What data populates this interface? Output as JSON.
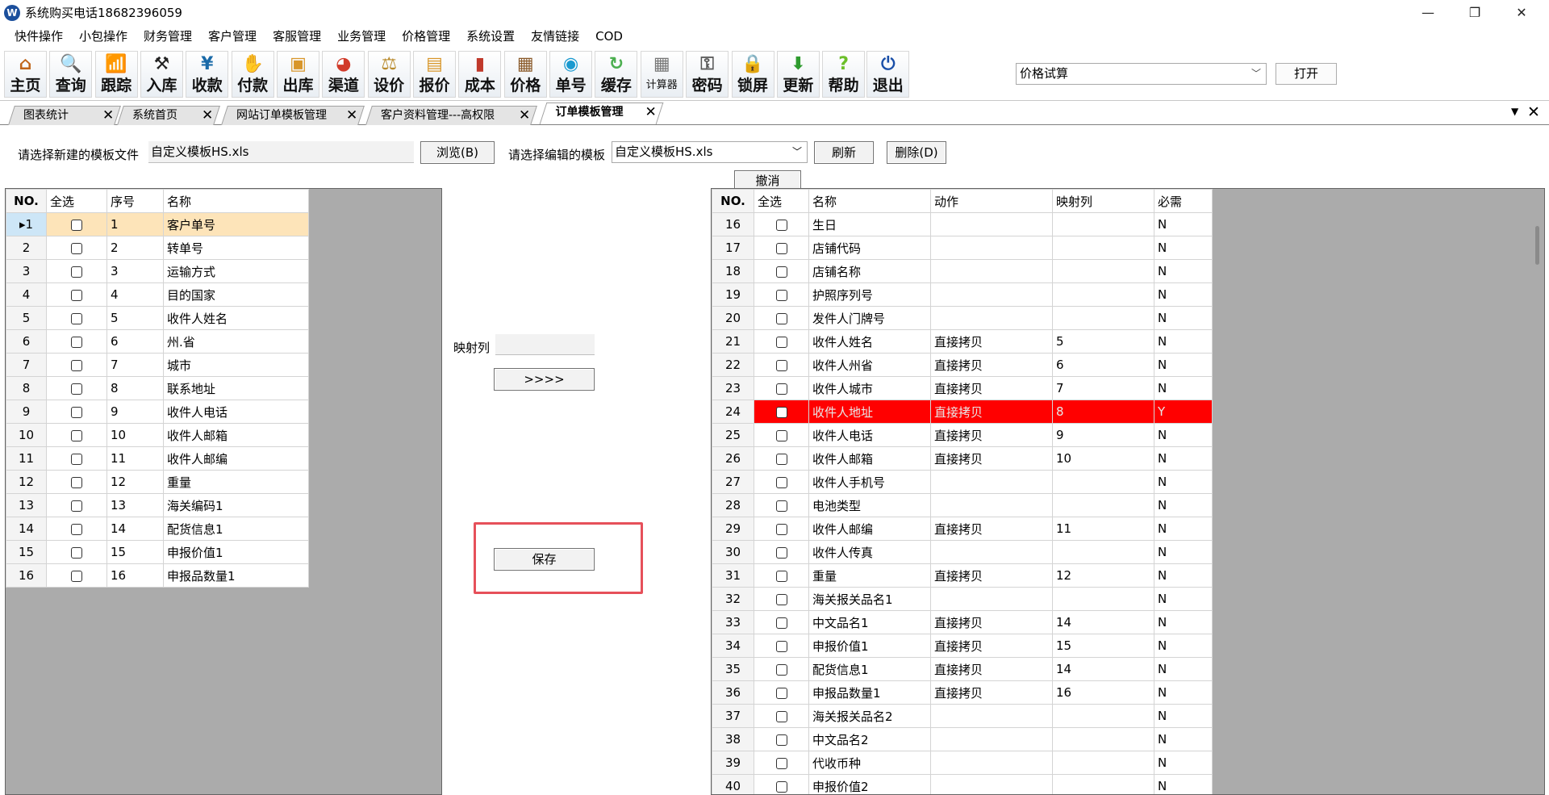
{
  "window": {
    "app_icon": "W",
    "title": "系统购买电话18682396059",
    "controls": [
      "—",
      "❐",
      "✕"
    ]
  },
  "menu": [
    "快件操作",
    "小包操作",
    "财务管理",
    "客户管理",
    "客服管理",
    "业务管理",
    "价格管理",
    "系统设置",
    "友情链接",
    "COD"
  ],
  "toolbar": {
    "buttons": [
      {
        "label": "主页",
        "icon": "home-icon",
        "glyph": "⌂",
        "color": "#c0651a"
      },
      {
        "label": "查询",
        "icon": "search-icon",
        "glyph": "🔍",
        "color": "#1a72c0"
      },
      {
        "label": "跟踪",
        "icon": "wifi-icon",
        "glyph": "📶",
        "color": "#1a5fa8"
      },
      {
        "label": "入库",
        "icon": "hammer-icon",
        "glyph": "⚒",
        "color": "#222222"
      },
      {
        "label": "收款",
        "icon": "yen-icon",
        "glyph": "¥",
        "color": "#1a6aa8"
      },
      {
        "label": "付款",
        "icon": "handshake-icon",
        "glyph": "✋",
        "color": "#c9a23a"
      },
      {
        "label": "出库",
        "icon": "box-icon",
        "glyph": "▣",
        "color": "#d8962a"
      },
      {
        "label": "渠道",
        "icon": "pie-icon",
        "glyph": "◕",
        "color": "#d13b2a"
      },
      {
        "label": "设价",
        "icon": "scale-icon",
        "glyph": "⚖",
        "color": "#b8892a"
      },
      {
        "label": "报价",
        "icon": "folder-icon",
        "glyph": "▤",
        "color": "#d8962a"
      },
      {
        "label": "成本",
        "icon": "bar-chart-icon",
        "glyph": "▮",
        "color": "#c0392b"
      },
      {
        "label": "价格",
        "icon": "tag-icon",
        "glyph": "▦",
        "color": "#8a5a2a"
      },
      {
        "label": "单号",
        "icon": "eye-icon",
        "glyph": "◉",
        "color": "#1a9ad0"
      },
      {
        "label": "缓存",
        "icon": "refresh-icon",
        "glyph": "↻",
        "color": "#4caf50"
      },
      {
        "label": "计算器",
        "icon": "calculator-icon",
        "glyph": "▦",
        "color": "#777777",
        "small": true
      },
      {
        "label": "密码",
        "icon": "key-icon",
        "glyph": "⚿",
        "color": "#555555"
      },
      {
        "label": "锁屏",
        "icon": "lock-icon",
        "glyph": "🔒",
        "color": "#777777"
      },
      {
        "label": "更新",
        "icon": "download-arrow-icon",
        "glyph": "⬇",
        "color": "#2e9b2e"
      },
      {
        "label": "帮助",
        "icon": "help-icon",
        "glyph": "?",
        "color": "#6cbf2a"
      },
      {
        "label": "退出",
        "icon": "power-icon",
        "glyph": "⏻",
        "color": "#1a4fa8"
      }
    ],
    "select_value": "价格试算",
    "open_label": "打开"
  },
  "tabs": [
    {
      "label": "图表统计",
      "active": false
    },
    {
      "label": "系统首页",
      "active": false
    },
    {
      "label": "网站订单模板管理",
      "active": false
    },
    {
      "label": "客户资料管理---高权限",
      "active": false
    },
    {
      "label": "订单模板管理",
      "active": true
    }
  ],
  "tab_controls": {
    "menu_arrow": "▼",
    "close_all": "✕",
    "tab_close": "✕"
  },
  "form": {
    "new_template_label": "请选择新建的模板文件",
    "new_template_value": "自定义模板HS.xls",
    "browse_label": "浏览(B)",
    "edit_template_label": "请选择编辑的模板",
    "edit_template_value": "自定义模板HS.xls",
    "refresh_label": "刷新",
    "delete_label": "删除(D)",
    "cancel_label": "撤消",
    "mapping_label": "映射列",
    "mapping_value": "",
    "arrow_label": ">>>>",
    "save_label": "保存"
  },
  "left_grid": {
    "columns": [
      "NO.",
      "全选",
      "序号",
      "名称"
    ],
    "rows": [
      {
        "no": "1",
        "seq": "1",
        "name": "客户单号",
        "selected": true
      },
      {
        "no": "2",
        "seq": "2",
        "name": "转单号"
      },
      {
        "no": "3",
        "seq": "3",
        "name": "运输方式"
      },
      {
        "no": "4",
        "seq": "4",
        "name": "目的国家"
      },
      {
        "no": "5",
        "seq": "5",
        "name": "收件人姓名"
      },
      {
        "no": "6",
        "seq": "6",
        "name": "州.省"
      },
      {
        "no": "7",
        "seq": "7",
        "name": "城市"
      },
      {
        "no": "8",
        "seq": "8",
        "name": "联系地址"
      },
      {
        "no": "9",
        "seq": "9",
        "name": "收件人电话"
      },
      {
        "no": "10",
        "seq": "10",
        "name": "收件人邮箱"
      },
      {
        "no": "11",
        "seq": "11",
        "name": "收件人邮编"
      },
      {
        "no": "12",
        "seq": "12",
        "name": "重量"
      },
      {
        "no": "13",
        "seq": "13",
        "name": "海关编码1"
      },
      {
        "no": "14",
        "seq": "14",
        "name": "配货信息1"
      },
      {
        "no": "15",
        "seq": "15",
        "name": "申报价值1"
      },
      {
        "no": "16",
        "seq": "16",
        "name": "申报品数量1"
      }
    ]
  },
  "right_grid": {
    "columns": [
      "NO.",
      "全选",
      "名称",
      "动作",
      "映射列",
      "必需"
    ],
    "rows": [
      {
        "no": "16",
        "name": "生日",
        "action": "",
        "map": "",
        "req": "N"
      },
      {
        "no": "17",
        "name": "店铺代码",
        "action": "",
        "map": "",
        "req": "N"
      },
      {
        "no": "18",
        "name": "店铺名称",
        "action": "",
        "map": "",
        "req": "N"
      },
      {
        "no": "19",
        "name": "护照序列号",
        "action": "",
        "map": "",
        "req": "N"
      },
      {
        "no": "20",
        "name": "发件人门牌号",
        "action": "",
        "map": "",
        "req": "N"
      },
      {
        "no": "21",
        "name": "收件人姓名",
        "action": "直接拷贝",
        "map": "5",
        "req": "N"
      },
      {
        "no": "22",
        "name": "收件人州省",
        "action": "直接拷贝",
        "map": "6",
        "req": "N"
      },
      {
        "no": "23",
        "name": "收件人城市",
        "action": "直接拷贝",
        "map": "7",
        "req": "N"
      },
      {
        "no": "24",
        "name": "收件人地址",
        "action": "直接拷贝",
        "map": "8",
        "req": "Y",
        "highlight": true
      },
      {
        "no": "25",
        "name": "收件人电话",
        "action": "直接拷贝",
        "map": "9",
        "req": "N"
      },
      {
        "no": "26",
        "name": "收件人邮箱",
        "action": "直接拷贝",
        "map": "10",
        "req": "N"
      },
      {
        "no": "27",
        "name": "收件人手机号",
        "action": "",
        "map": "",
        "req": "N"
      },
      {
        "no": "28",
        "name": "电池类型",
        "action": "",
        "map": "",
        "req": "N"
      },
      {
        "no": "29",
        "name": "收件人邮编",
        "action": "直接拷贝",
        "map": "11",
        "req": "N"
      },
      {
        "no": "30",
        "name": "收件人传真",
        "action": "",
        "map": "",
        "req": "N"
      },
      {
        "no": "31",
        "name": "重量",
        "action": "直接拷贝",
        "map": "12",
        "req": "N"
      },
      {
        "no": "32",
        "name": "海关报关品名1",
        "action": "",
        "map": "",
        "req": "N"
      },
      {
        "no": "33",
        "name": "中文品名1",
        "action": "直接拷贝",
        "map": "14",
        "req": "N"
      },
      {
        "no": "34",
        "name": "申报价值1",
        "action": "直接拷贝",
        "map": "15",
        "req": "N"
      },
      {
        "no": "35",
        "name": "配货信息1",
        "action": "直接拷贝",
        "map": "14",
        "req": "N"
      },
      {
        "no": "36",
        "name": "申报品数量1",
        "action": "直接拷贝",
        "map": "16",
        "req": "N"
      },
      {
        "no": "37",
        "name": "海关报关品名2",
        "action": "",
        "map": "",
        "req": "N"
      },
      {
        "no": "38",
        "name": "中文品名2",
        "action": "",
        "map": "",
        "req": "N"
      },
      {
        "no": "39",
        "name": "代收币种",
        "action": "",
        "map": "",
        "req": "N"
      },
      {
        "no": "40",
        "name": "申报价值2",
        "action": "",
        "map": "",
        "req": "N"
      }
    ]
  },
  "colors": {
    "highlight_row": "#ff0000",
    "selected_row": "#fde4b9",
    "annotation_box": "#e6505a"
  }
}
